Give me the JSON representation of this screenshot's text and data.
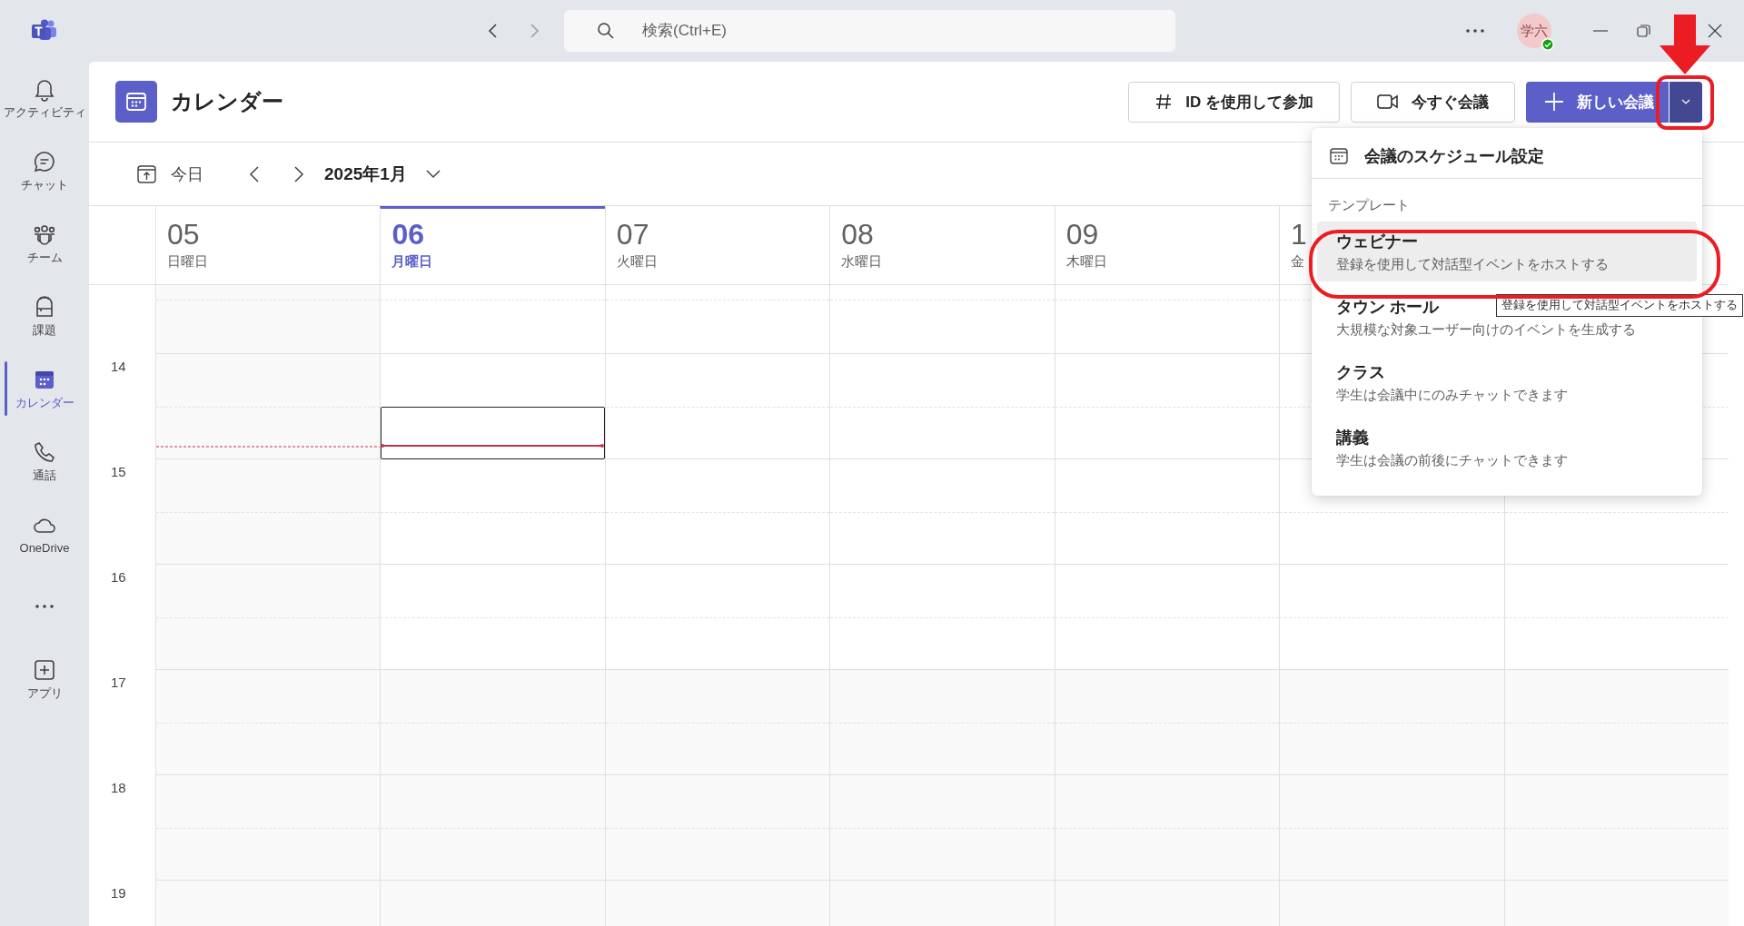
{
  "titlebar": {
    "search": {
      "placeholder": "検索(Ctrl+E)"
    },
    "avatar": {
      "initials": "学六",
      "online": true
    }
  },
  "sidebar": {
    "items": [
      {
        "kind": "app",
        "label": "アクティビティ",
        "selected": false
      },
      {
        "kind": "app",
        "label": "チャット",
        "selected": false
      },
      {
        "kind": "app",
        "label": "チーム",
        "selected": false
      },
      {
        "kind": "app",
        "label": "課題",
        "selected": false
      },
      {
        "kind": "app",
        "label": "カレンダー",
        "selected": true
      },
      {
        "kind": "app",
        "label": "通話",
        "selected": false
      },
      {
        "kind": "app",
        "label": "OneDrive",
        "selected": false
      },
      {
        "kind": "more"
      },
      {
        "kind": "app",
        "label": "アプリ",
        "selected": false
      }
    ]
  },
  "header": {
    "title": "カレンダー",
    "buttons": [
      {
        "kind": "outline",
        "label": "ID を使用して参加"
      },
      {
        "kind": "outline",
        "label": "今すぐ会議"
      },
      {
        "kind": "primary",
        "label": "新しい会議"
      }
    ]
  },
  "toolbar": {
    "today": "今日",
    "month": "2025年1月"
  },
  "calendar": {
    "days": [
      {
        "date": "05",
        "weekday": "日曜日",
        "selected": false,
        "weekend": true
      },
      {
        "date": "06",
        "weekday": "月曜日",
        "selected": true,
        "weekend": false
      },
      {
        "date": "07",
        "weekday": "火曜日",
        "selected": false,
        "weekend": false
      },
      {
        "date": "08",
        "weekday": "水曜日",
        "selected": false,
        "weekend": false
      },
      {
        "date": "09",
        "weekday": "木曜日",
        "selected": false,
        "weekend": false
      },
      {
        "date": "1",
        "weekday": "金",
        "selected": false,
        "weekend": false
      }
    ],
    "hours": [
      "14",
      "15",
      "16",
      "17",
      "18",
      "19"
    ]
  },
  "menu": {
    "items": [
      {
        "kind": "action",
        "label": "会議のスケジュール設定"
      },
      {
        "kind": "heading",
        "label": "テンプレート"
      },
      {
        "kind": "template",
        "title": "ウェビナー",
        "description": "登録を使用して対話型イベントをホストする",
        "selected": true
      },
      {
        "kind": "template",
        "title": "タウン ホール",
        "description": "大規模な対象ユーザー向けのイベントを生成する",
        "selected": false
      },
      {
        "kind": "template",
        "title": "クラス",
        "description": "学生は会議中にのみチャットできます",
        "selected": false
      },
      {
        "kind": "template",
        "title": "講義",
        "description": "学生は会議の前後にチャットできます",
        "selected": false
      }
    ]
  },
  "tooltip": {
    "text": "登録を使用して対話型イベントをホストする"
  }
}
